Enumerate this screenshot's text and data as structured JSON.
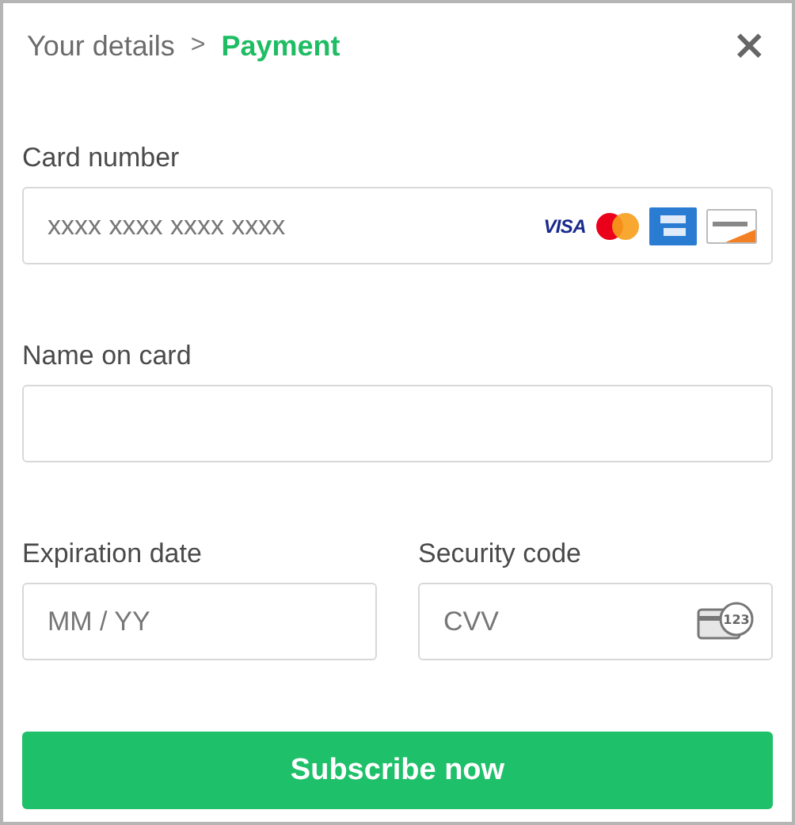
{
  "breadcrumb": [
    {
      "label": "Your details",
      "selected": false
    },
    {
      "label": "Payment",
      "selected": true
    }
  ],
  "breadcrumb_separator": ">",
  "close_button": "×",
  "card_number": {
    "label": "Card number",
    "placeholder": "xxxx xxxx xxxx xxxx",
    "brands": [
      "VISA"
    ]
  },
  "name_on_card": {
    "label": "Name on card"
  },
  "expiration_date": {
    "label": "Expiration date",
    "placeholder": "MM / YY"
  },
  "security_code": {
    "label": "Security code",
    "placeholder": "CVV",
    "icon_text": "123"
  },
  "submit_button": "Subscribe now"
}
